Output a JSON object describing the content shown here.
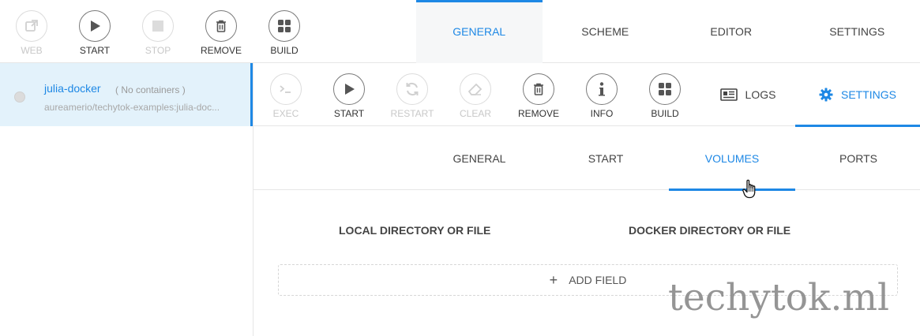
{
  "app_toolbar": {
    "web": "WEB",
    "start": "START",
    "stop": "STOP",
    "remove": "REMOVE",
    "build": "BUILD"
  },
  "app_tabs": [
    "GENERAL",
    "SCHEME",
    "EDITOR",
    "SETTINGS"
  ],
  "sidebar": {
    "container_name": "julia-docker",
    "container_state": "( No containers )",
    "container_image": "aureamerio/techytok-examples:julia-doc..."
  },
  "container_toolbar": {
    "exec": "EXEC",
    "start": "START",
    "restart": "RESTART",
    "clear": "CLEAR",
    "remove": "REMOVE",
    "info": "INFO",
    "build": "BUILD",
    "logs_tab": "LOGS",
    "settings_tab": "SETTINGS"
  },
  "sub_tabs": [
    "GENERAL",
    "START",
    "VOLUMES",
    "PORTS"
  ],
  "volumes": {
    "local_header": "LOCAL DIRECTORY OR FILE",
    "docker_header": "DOCKER DIRECTORY OR FILE",
    "add_field": "ADD FIELD"
  },
  "watermark": "techytok.ml",
  "colors": {
    "accent": "#1e88e5",
    "selected_bg": "#e3f2fb",
    "disabled": "#c8c8c8"
  },
  "icons": [
    "external-link-icon",
    "play-icon",
    "stop-icon",
    "trash-icon",
    "grid-icon",
    "terminal-icon",
    "refresh-icon",
    "eraser-icon",
    "info-icon",
    "logs-icon",
    "gear-icon",
    "plus-icon",
    "hand-cursor-icon"
  ]
}
